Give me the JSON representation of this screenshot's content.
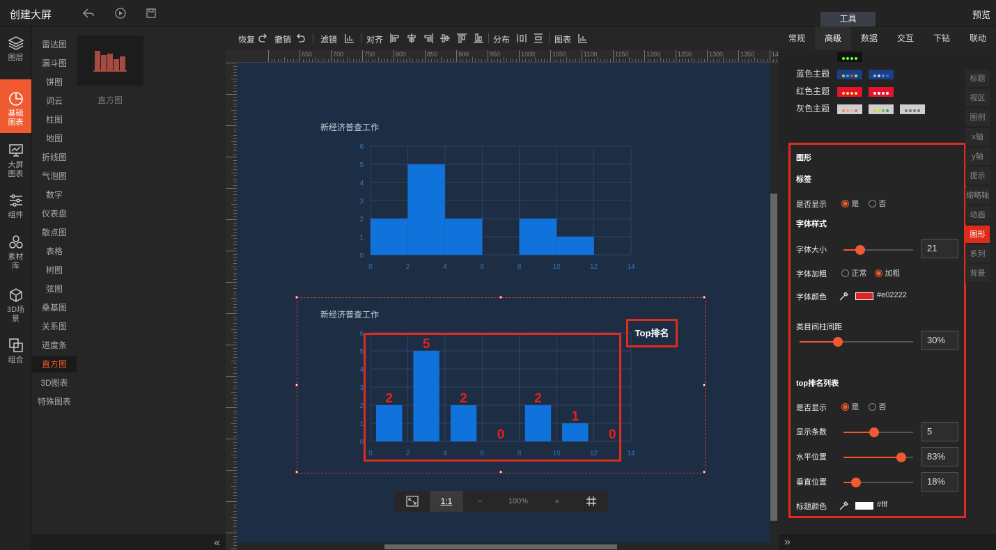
{
  "header": {
    "title": "创建大屏",
    "preview": "预览",
    "tools_tab": "工具"
  },
  "left_bar": [
    {
      "label": "图层",
      "icon": "layers-icon"
    },
    {
      "label": "基础图表",
      "icon": "pie-chart-icon",
      "active": true
    },
    {
      "label": "大屏图表",
      "icon": "screen-chart-icon"
    },
    {
      "label": "组件",
      "icon": "sliders-icon"
    },
    {
      "label": "素材库",
      "icon": "hexagons-icon"
    },
    {
      "label": "3D场景",
      "icon": "cube-icon"
    },
    {
      "label": "组合",
      "icon": "combine-icon"
    }
  ],
  "categories": [
    "雷达图",
    "漏斗图",
    "饼图",
    "词云",
    "柱图",
    "地图",
    "折线图",
    "气泡图",
    "数字",
    "仪表盘",
    "散点图",
    "表格",
    "树图",
    "弦图",
    "桑基图",
    "关系图",
    "进度条",
    "直方图",
    "3D图表",
    "特殊图表"
  ],
  "active_category": "直方图",
  "thumb_label": "直方图",
  "toolbar": {
    "redo": "恢复",
    "undo": "撤销",
    "filter": "滤镜",
    "align": "对齐",
    "distribute": "分布",
    "chart": "图表"
  },
  "ruler_labels": [
    "650",
    "700",
    "750",
    "800",
    "850",
    "900",
    "950",
    "1000",
    "1050",
    "1100",
    "1150",
    "1200",
    "1250",
    "1300",
    "1350",
    "1400"
  ],
  "zoom": {
    "ratio": "1:1",
    "minus": "−",
    "level": "100%",
    "plus": "+"
  },
  "chart_data": [
    {
      "type": "bar",
      "title": "新经济普查工作",
      "bins": [
        [
          0,
          2
        ],
        [
          2,
          4
        ],
        [
          4,
          6
        ],
        [
          6,
          8
        ],
        [
          8,
          10
        ],
        [
          10,
          12
        ],
        [
          12,
          14
        ]
      ],
      "values": [
        2,
        5,
        2,
        0,
        2,
        1,
        0
      ],
      "xticks": [
        "0",
        "2",
        "4",
        "6",
        "8",
        "10",
        "12",
        "14"
      ],
      "yticks": [
        "0",
        "1",
        "2",
        "3",
        "4",
        "5",
        "6"
      ],
      "ylim": [
        0,
        6
      ],
      "xlim": [
        0,
        14
      ],
      "grid": true,
      "color": "#0f73db"
    },
    {
      "type": "bar",
      "title": "新经济普查工作",
      "bins": [
        [
          0.3,
          1.7
        ],
        [
          2.3,
          3.7
        ],
        [
          4.3,
          5.7
        ],
        [
          6.3,
          7.7
        ],
        [
          8.3,
          9.7
        ],
        [
          10.3,
          11.7
        ],
        [
          12.3,
          13.7
        ]
      ],
      "values": [
        2,
        5,
        2,
        0,
        2,
        1,
        0
      ],
      "data_labels": [
        "2",
        "5",
        "2",
        "0",
        "2",
        "1",
        "0"
      ],
      "xticks": [
        "0",
        "2",
        "4",
        "6",
        "8",
        "10",
        "12",
        "14"
      ],
      "yticks": [
        "0",
        "1",
        "2",
        "3",
        "4",
        "5",
        "6"
      ],
      "ylim": [
        0,
        6
      ],
      "xlim": [
        0,
        14
      ],
      "grid": true,
      "color": "#0f73db",
      "label_color": "#e02222",
      "top_list_title": "Top排名"
    }
  ],
  "right_panel": {
    "tabs": [
      "常规",
      "高级",
      "数据",
      "交互",
      "下钻",
      "联动"
    ],
    "active_tab": "高级",
    "themes": [
      {
        "label": "蓝色主题",
        "swatches": [
          {
            "bg": "#1a3f82",
            "dots": [
              "#ffb400",
              "#00c8ff",
              "#ff3a3a",
              "#8cff4a"
            ]
          },
          {
            "bg": "#1a3f82",
            "dots": [
              "#8ab4ff",
              "#c7d8ff",
              "#5a8ae0",
              "#2f6bd0"
            ]
          }
        ]
      },
      {
        "label": "红色主题",
        "swatches": [
          {
            "bg": "#e5132f",
            "dots": [
              "#ffe45c",
              "#ffe45c",
              "#ffe45c",
              "#ffe45c"
            ]
          },
          {
            "bg": "#e5132f",
            "dots": [
              "#ffffff",
              "#ffffff",
              "#ffffff",
              "#ffffff"
            ]
          }
        ]
      },
      {
        "label": "灰色主题",
        "swatches": [
          {
            "bg": "#cfcfcf",
            "dots": [
              "#f08c5c",
              "#f0a080",
              "#f0b090",
              "#e07070"
            ]
          },
          {
            "bg": "#cfcfcf",
            "dots": [
              "#e8c840",
              "#c8e040",
              "#60c060",
              "#50a050"
            ]
          },
          {
            "bg": "#cfcfcf",
            "dots": [
              "#777777",
              "#777777",
              "#777777",
              "#777777"
            ]
          }
        ]
      }
    ],
    "vtabs": [
      "标题",
      "视区",
      "图例",
      "x轴",
      "y轴",
      "提示",
      "缩略轴",
      "动画",
      "图形",
      "系列",
      "背景"
    ],
    "active_vtab": "图形",
    "config": {
      "section_shape": "图形",
      "section_label": "标签",
      "show_label": "是否显示",
      "yes": "是",
      "no": "否",
      "font_style": "字体样式",
      "font_size_label": "字体大小",
      "font_size_value": "21",
      "font_size_level": 0.24,
      "font_weight_label": "字体加粗",
      "weight_normal": "正常",
      "weight_bold": "加粗",
      "font_color_label": "字体颜色",
      "font_color": "#e02222",
      "gap_label": "类目间柱间距",
      "gap_value": "30%",
      "gap_level": 0.34,
      "toplist_section": "top排名列表",
      "toplist_show": "是否显示",
      "count_label": "显示条数",
      "count_value": "5",
      "count_level": 0.44,
      "hpos_label": "水平位置",
      "hpos_value": "83%",
      "hpos_level": 0.83,
      "vpos_label": "垂直位置",
      "vpos_value": "18%",
      "vpos_level": 0.18,
      "title_color_label": "标题颜色",
      "title_color": "#fff"
    }
  }
}
